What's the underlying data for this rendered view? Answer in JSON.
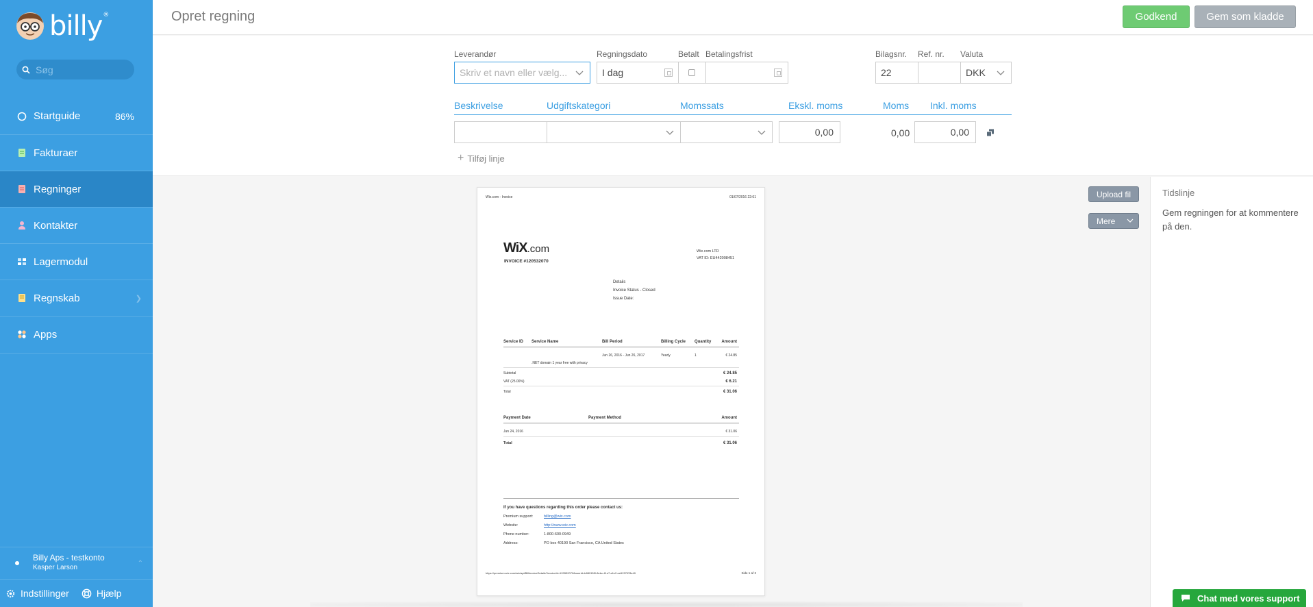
{
  "brand": {
    "name": "billy",
    "reg": "®"
  },
  "search": {
    "placeholder": "Søg"
  },
  "nav": {
    "items": [
      {
        "label": "Startguide",
        "badge": "86%"
      },
      {
        "label": "Fakturaer"
      },
      {
        "label": "Regninger"
      },
      {
        "label": "Kontakter"
      },
      {
        "label": "Lagermodul"
      },
      {
        "label": "Regnskab"
      },
      {
        "label": "Apps"
      }
    ]
  },
  "account": {
    "name": "Billy Aps - testkonto",
    "user": "Kasper Larson"
  },
  "bottom": {
    "settings": "Indstillinger",
    "help": "Hjælp"
  },
  "header": {
    "title": "Opret regning",
    "approve": "Godkend",
    "save_draft": "Gem som kladde"
  },
  "form": {
    "supplier_label": "Leverandør",
    "supplier_placeholder": "Skriv et navn eller vælg...",
    "date_label": "Regningsdato",
    "date_value": "I dag",
    "paid_label": "Betalt",
    "due_label": "Betalingsfrist",
    "voucher_label": "Bilagsnr.",
    "voucher_value": "22",
    "ref_label": "Ref. nr.",
    "currency_label": "Valuta",
    "currency_value": "DKK"
  },
  "lines": {
    "columns": [
      "Beskrivelse",
      "Udgiftskategori",
      "Momssats",
      "Ekskl. moms",
      "Moms",
      "Inkl. moms"
    ],
    "row": {
      "excl": "0,00",
      "vat": "0,00",
      "incl": "0,00"
    },
    "add_line": "Tilføj linje"
  },
  "actions": {
    "upload": "Upload fil",
    "more": "Mere"
  },
  "timeline": {
    "title": "Tidslinje",
    "text": "Gem regningen for at kommentere på den."
  },
  "chat": {
    "label": "Chat med vores support"
  },
  "colors": {
    "sidebar": "#3c9fe2",
    "sidebar_active": "#2a86c7",
    "approve": "#6ecb73",
    "draft": "#a9b1b8",
    "chat": "#26a73c"
  },
  "invoice": {
    "top_left": "Wix.com - Invoice",
    "top_right": "01/07/2016 22:61",
    "logo_main": "WiX",
    "logo_com": ".com",
    "invoice_no": "INVOICE #120532070",
    "company": "Wix.com LTD",
    "vat_id": "VAT ID: EU442008451",
    "details_title": "Details",
    "details_status": "Invoice Status - Closed",
    "details_issue": "Issue Date:",
    "service_headers": [
      "Service ID",
      "Service Name",
      "Bill Period",
      "Billing Cycle",
      "Quantity",
      "Amount"
    ],
    "service_row": {
      "period": "Jun 26, 2016 - Jun 26, 2017",
      "cycle": "Yearly",
      "qty": "1",
      "amount": "€ 24.85"
    },
    "service_desc": ".NET domain 1 year free with privacy",
    "subtotal_label": "Subtotal",
    "subtotal": "€ 24.85",
    "vat_label": "VAT (25.00%)",
    "vat": "€ 6.21",
    "total_label": "Total",
    "total": "€ 31.06",
    "payment_headers": [
      "Payment Date",
      "Payment Method",
      "Amount"
    ],
    "payment_date": "Jun 24, 2016",
    "payment_amount": "€ 31.06",
    "payment_total_label": "Total",
    "payment_total": "€ 31.06",
    "contact_title": "If you have questions regarding this order please contact us:",
    "contact": [
      {
        "label": "Premium support:",
        "value": "billing@wix.com",
        "link": true
      },
      {
        "label": "Website:",
        "value": "http://www.wix.com",
        "link": true
      },
      {
        "label": "Phone number:",
        "value": "1-800-600-0949",
        "link": false
      },
      {
        "label": "Address:",
        "value": "PO box 40190 San Francisco, CA United States",
        "link": false
      }
    ],
    "footer_url": "https://premium.wix.com/wix/api/BillInvoiceDetails?invoiceId=120532070&userId=b88915f0-8ebc-41e7-a1c2-ce8137578e49",
    "footer_page": "Side 1 af 2"
  }
}
